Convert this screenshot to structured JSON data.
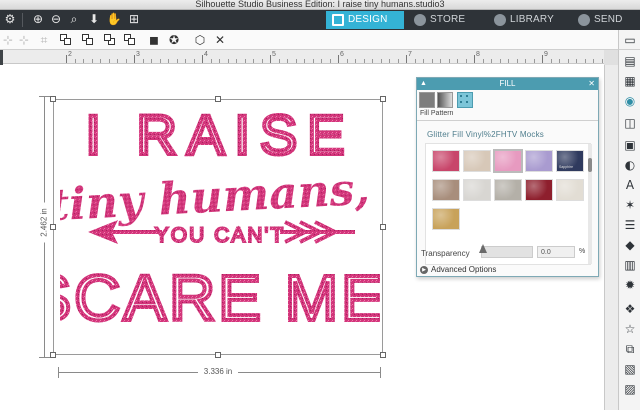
{
  "window": {
    "title": "Silhouette Studio Business Edition: I raise tiny humans.studio3"
  },
  "toolbar": {
    "tabs": [
      {
        "label": "DESIGN",
        "active": true
      },
      {
        "label": "STORE",
        "active": false
      },
      {
        "label": "LIBRARY",
        "active": false
      },
      {
        "label": "SEND",
        "active": false
      }
    ],
    "icons": [
      "zoom-in-icon",
      "zoom-out-icon",
      "zoom-select-icon",
      "move-down-icon",
      "pan-hand-icon",
      "fit-to-page-icon"
    ]
  },
  "ruler": {
    "labels": [
      "2",
      "3",
      "4",
      "5",
      "6",
      "7",
      "8",
      "9"
    ]
  },
  "design": {
    "lines": [
      "I RAISE",
      "tiny humans,",
      "YOU CAN'T",
      "SCARE ME."
    ],
    "fill_color": "#d2357a"
  },
  "dimensions": {
    "width": "3.336 in",
    "height": "2.462 in"
  },
  "fill_panel": {
    "title": "FILL",
    "tab_label": "Fill Pattern",
    "group_title": "Glitter Fill Vinyl%2FHTV Mocks",
    "swatches": [
      {
        "name": "pink-glitter",
        "color": "#c8456a"
      },
      {
        "name": "champagne-glitter",
        "color": "#d7c8b8"
      },
      {
        "name": "light-pink-glitter",
        "color": "#e79ac0",
        "selected": true
      },
      {
        "name": "lavender-glitter",
        "color": "#a99bd0"
      },
      {
        "name": "navy-glitter",
        "color": "#2f3a5e",
        "caption": "Sapphire"
      },
      {
        "name": "bronze-glitter",
        "color": "#a88e7c"
      },
      {
        "name": "silver-glitter",
        "color": "#d8d6d2"
      },
      {
        "name": "gray-glitter",
        "color": "#b4b0a8"
      },
      {
        "name": "red-glitter",
        "color": "#8e1f2d"
      },
      {
        "name": "white-glitter",
        "color": "#e2ddd4"
      },
      {
        "name": "gold-glitter",
        "color": "#c8a25a"
      }
    ],
    "transparency": {
      "label": "Transparency",
      "value": "0.0",
      "unit": "%"
    },
    "advanced_label": "Advanced Options"
  }
}
